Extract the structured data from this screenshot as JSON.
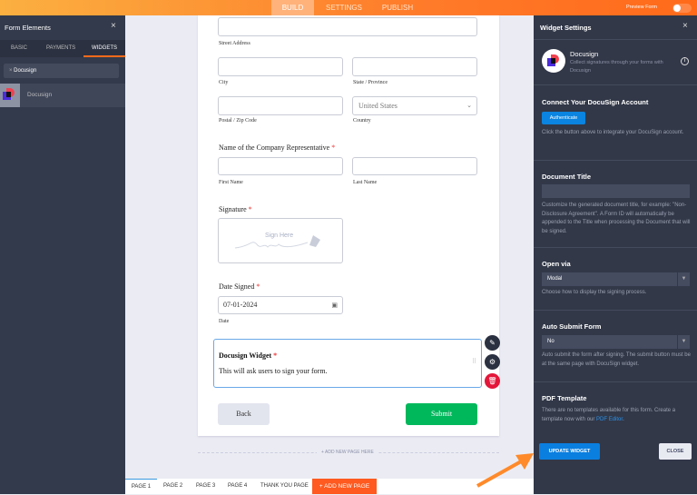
{
  "topbar": {
    "tabs": [
      "BUILD",
      "SETTINGS",
      "PUBLISH"
    ],
    "preview_label": "Preview Form"
  },
  "left": {
    "title": "Form Elements",
    "tabs": [
      "BASIC",
      "PAYMENTS",
      "WIDGETS"
    ],
    "search_value": "Docusign",
    "item": "Docusign"
  },
  "form": {
    "street": "Street Address",
    "city": "City",
    "state": "State / Province",
    "postal": "Postal / Zip Code",
    "country_label": "Country",
    "country_value": "United States",
    "rep_question": "Name of the Company Representative",
    "first": "First Name",
    "last": "Last Name",
    "signature": "Signature",
    "sign_here": "Sign Here",
    "date_q": "Date Signed",
    "date_value": "07-01-2024",
    "date_label": "Date",
    "widget_title": "Docusign Widget",
    "widget_desc": "This will ask users to sign your form.",
    "back": "Back",
    "submit": "Submit",
    "required": "*",
    "add_page_here": "+ ADD NEW PAGE HERE"
  },
  "pages": {
    "tabs": [
      "PAGE 1",
      "PAGE 2",
      "PAGE 3",
      "PAGE 4",
      "THANK YOU PAGE"
    ],
    "add": "+ ADD NEW PAGE"
  },
  "settings": {
    "title": "Widget Settings",
    "widget_name": "Docusign",
    "widget_desc": "Collect signatures through your forms with Docusign",
    "connect_title": "Connect Your DocuSign Account",
    "authenticate": "Authenticate",
    "connect_desc": "Click the button above to integrate your DocuSign account.",
    "doc_title": "Document Title",
    "doc_value": "",
    "doc_desc": "Customize the generated document title, for example: \"Non-Disclosure Agreement\". A Form ID will automatically be appended to the Title when processing the Document that will be signed.",
    "open_title": "Open via",
    "open_value": "Modal",
    "open_desc": "Choose how to display the signing process.",
    "auto_title": "Auto Submit Form",
    "auto_value": "No",
    "auto_desc": "Auto submit the form after signing. The submit button must be at the same page with DocuSign widget.",
    "pdf_title": "PDF Template",
    "pdf_desc": "There are no templates available for this form. Create a template now with our",
    "pdf_link": "PDF Editor",
    "update": "UPDATE WIDGET",
    "close": "CLOSE"
  },
  "colors": {
    "accent": "#ff6a1a",
    "blue": "#0a84e0",
    "green": "#00b85c"
  }
}
